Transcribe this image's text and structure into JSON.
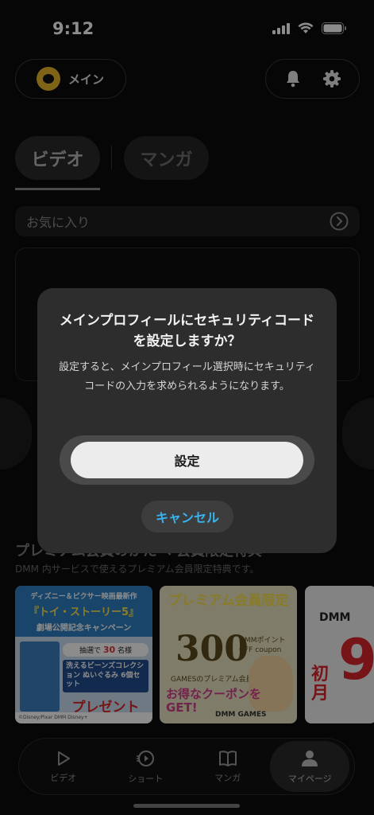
{
  "status_bar": {
    "time": "9:12"
  },
  "header": {
    "profile_name": "メイン"
  },
  "tabs": [
    {
      "label": "ビデオ"
    },
    {
      "label": "マンガ"
    }
  ],
  "favorites": {
    "label": "お気に入り"
  },
  "premium": {
    "title": "プレミアム会員のかたへ 会員限定特典",
    "subtitle": "DMM 内サービスで使えるプレミアム会員限定特典です。",
    "banners": [
      {
        "line1": "ディズニー＆ピクサー映画最新作",
        "line2": "『トイ・ストーリー5』",
        "line3": "劇場公開記念キャンペーン",
        "lottery_prefix": "抽選で",
        "lottery_count": "30",
        "lottery_suffix": "名様",
        "set_text": "洗えるビーンズコレクション ぬいぐるみ 6個セット",
        "present": "プレゼント",
        "footer": "©Disney/Pixar  DMM  Disney+"
      },
      {
        "head": "プレミアム会員限定",
        "amount": "300",
        "coupon": "DMMポイント OFF coupon",
        "games": "GAMESのプレミアム会員",
        "get_line1": "お得なクーポンを",
        "get_line2": "GET!",
        "footer": "DMM GAMES"
      },
      {
        "logo": "DMM",
        "big": "9",
        "first": "初月"
      }
    ]
  },
  "nav": [
    {
      "label": "ビデオ",
      "icon": "play-icon"
    },
    {
      "label": "ショート",
      "icon": "short-play-icon"
    },
    {
      "label": "マンガ",
      "icon": "book-icon"
    },
    {
      "label": "マイページ",
      "icon": "person-icon"
    }
  ],
  "dialog": {
    "title": "メインプロフィールにセキュリティコードを設定しますか？",
    "body": "設定すると、メインプロフィール選択時にセキュリティコードの入力を求められるようになります。",
    "confirm_label": "設定",
    "cancel_label": "キャンセル"
  }
}
